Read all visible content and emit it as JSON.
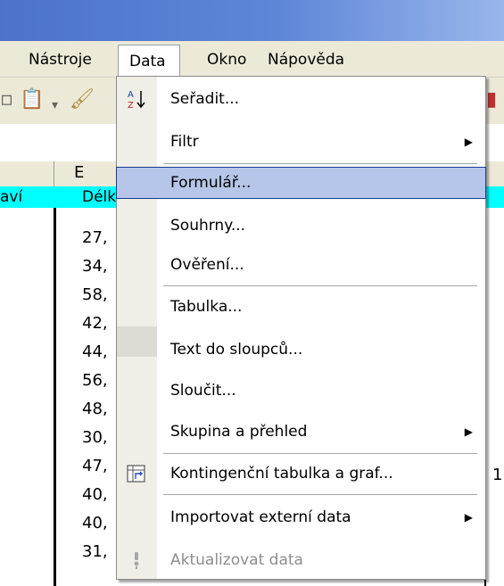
{
  "menubar": {
    "items": [
      {
        "label": "Nástroje"
      },
      {
        "label": "Data"
      },
      {
        "label": "Okno"
      },
      {
        "label": "Nápověda"
      }
    ]
  },
  "sheet": {
    "column_header": "E",
    "row1_left": "aví",
    "row1_col_e": "Délk",
    "values": [
      "27,",
      "34,",
      "58,",
      "42,",
      "44,",
      "56,",
      "48,",
      "30,",
      "47,",
      "40,",
      "40,",
      "31,"
    ],
    "right_edge_value": "1"
  },
  "dropdown": {
    "items": [
      {
        "label": "Seřadit...",
        "has_submenu": false,
        "icon": "sort-az-icon"
      },
      {
        "label": "Filtr",
        "has_submenu": true
      },
      {
        "label": "Formulář...",
        "has_submenu": false,
        "highlighted": true
      },
      {
        "label": "Souhrny...",
        "has_submenu": false
      },
      {
        "label": "Ověření...",
        "has_submenu": false
      },
      {
        "label": "Tabulka...",
        "has_submenu": false
      },
      {
        "label": "Text do sloupců...",
        "has_submenu": false
      },
      {
        "label": "Sloučit...",
        "has_submenu": false
      },
      {
        "label": "Skupina a přehled",
        "has_submenu": true
      },
      {
        "label": "Kontingenční tabulka a graf...",
        "has_submenu": false,
        "icon": "pivot-table-icon"
      },
      {
        "label": "Importovat externí data",
        "has_submenu": true
      },
      {
        "label": "Aktualizovat data",
        "has_submenu": false,
        "disabled": true,
        "icon": "refresh-data-icon"
      }
    ]
  },
  "colors": {
    "highlight_bg": "#b6c6e8",
    "highlight_border": "#1a3b8f",
    "header_cyan": "#00ffff"
  }
}
